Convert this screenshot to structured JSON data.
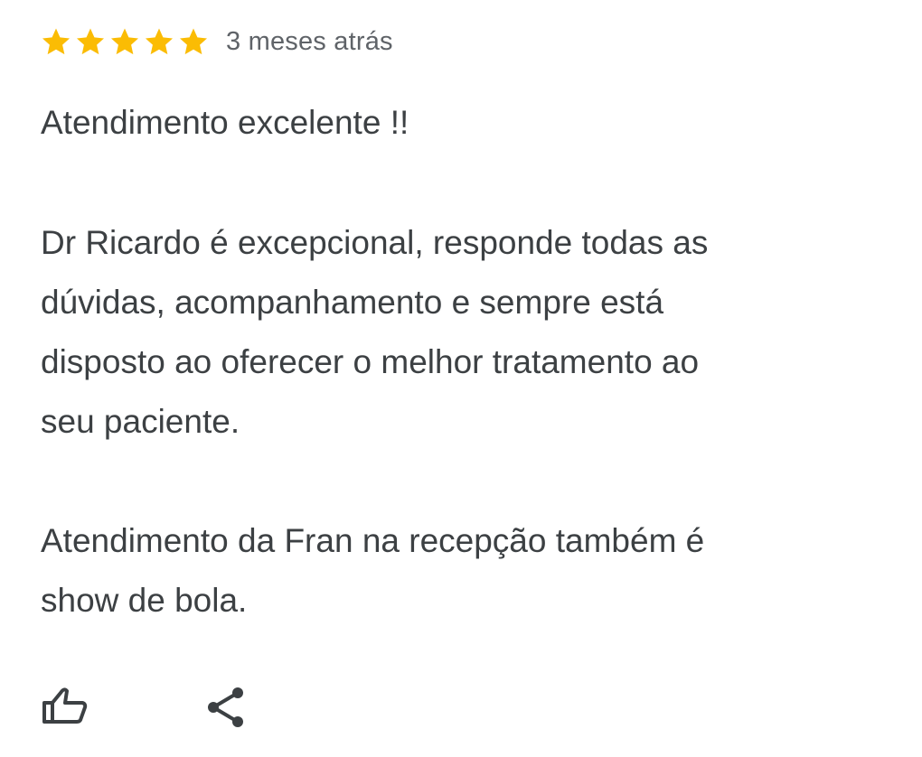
{
  "review": {
    "rating": 5,
    "rating_max": 5,
    "time_ago": "3 meses atrás",
    "paragraphs": [
      [
        "Atendimento excelente !!"
      ],
      [
        "Dr Ricardo é excepcional, responde todas as",
        "dúvidas, acompanhamento e sempre está",
        "disposto ao oferecer o melhor tratamento ao",
        "seu paciente."
      ],
      [
        "Atendimento da Fran na recepção também é",
        "show de bola."
      ]
    ]
  },
  "actions": {
    "like_icon": "thumbs-up-outline-icon",
    "share_icon": "share-icon"
  },
  "colors": {
    "star": "#fbbc04",
    "text": "#3c4043",
    "secondary_text": "#5f6368",
    "icon": "#3c4043"
  }
}
